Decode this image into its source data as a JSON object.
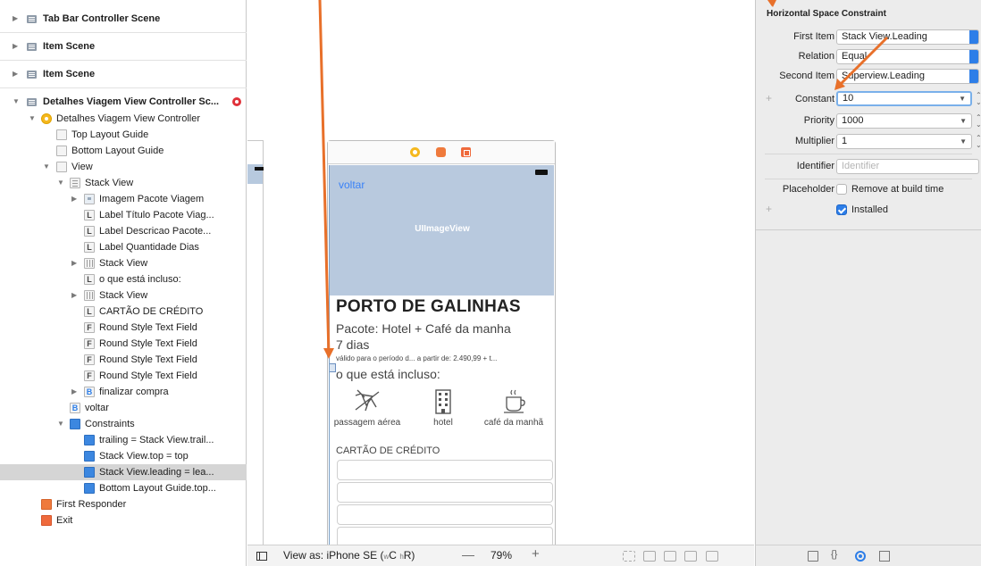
{
  "outline": {
    "scenes": [
      {
        "label": "Tab Bar Controller Scene"
      },
      {
        "label": "Item Scene"
      },
      {
        "label": "Item Scene"
      },
      {
        "label": "Detalhes Viagem View Controller Sc..."
      }
    ],
    "rows": [
      {
        "label": "Detalhes Viagem View Controller"
      },
      {
        "label": "Top Layout Guide"
      },
      {
        "label": "Bottom Layout Guide"
      },
      {
        "label": "View"
      },
      {
        "label": "Stack View"
      },
      {
        "label": "Imagem Pacote Viagem"
      },
      {
        "label": "Label Título Pacote Viag..."
      },
      {
        "label": "Label Descricao Pacote..."
      },
      {
        "label": "Label Quantidade Dias"
      },
      {
        "label": "Stack View"
      },
      {
        "label": "o que está incluso:"
      },
      {
        "label": "Stack View"
      },
      {
        "label": "CARTÃO DE CRÉDITO"
      },
      {
        "label": "Round Style Text Field"
      },
      {
        "label": "Round Style Text Field"
      },
      {
        "label": "Round Style Text Field"
      },
      {
        "label": "Round Style Text Field"
      },
      {
        "label": "finalizar compra"
      },
      {
        "label": "voltar"
      },
      {
        "label": "Constraints"
      },
      {
        "label": "trailing = Stack View.trail..."
      },
      {
        "label": "Stack View.top = top"
      },
      {
        "label": "Stack View.leading = lea..."
      },
      {
        "label": "Bottom Layout Guide.top..."
      },
      {
        "label": "First Responder"
      },
      {
        "label": "Exit"
      }
    ],
    "icon_letters": {
      "label": "L",
      "field": "F",
      "button": "B"
    }
  },
  "canvas": {
    "voltar": "voltar",
    "image_placeholder": "UIImageView",
    "title": "PORTO DE GALINHAS",
    "pacote": "Pacote: Hotel + Café da manha",
    "dias": "7 dias",
    "validade": "válido para o período d... a partir de: 2.490,99 + t...",
    "incluso": "o que está incluso:",
    "features": [
      {
        "label": "passagem aérea",
        "icon": "airplane-icon"
      },
      {
        "label": "hotel",
        "icon": "hotel-icon"
      },
      {
        "label": "café da manhã",
        "icon": "coffee-cup-icon"
      }
    ],
    "cartao": "CARTÃO DE CRÉDITO"
  },
  "bottombar": {
    "view_as": "View as: iPhone SE (",
    "size_class_w": "w",
    "size_class_c": "C",
    "size_class_h": "h",
    "size_class_r": "R)",
    "zoom_minus": "—",
    "zoom": "79%",
    "zoom_plus": "+"
  },
  "inspector": {
    "title": "Horizontal Space Constraint",
    "first_item_label": "First Item",
    "first_item_value": "Stack View.Leading",
    "relation_label": "Relation",
    "relation_value": "Equal",
    "second_item_label": "Second Item",
    "second_item_value": "Superview.Leading",
    "constant_label": "Constant",
    "constant_value": "10",
    "priority_label": "Priority",
    "priority_value": "1000",
    "multiplier_label": "Multiplier",
    "multiplier_value": "1",
    "identifier_label": "Identifier",
    "identifier_placeholder": "Identifier",
    "placeholder_label": "Placeholder",
    "remove_label": "Remove at build time",
    "installed_label": "Installed",
    "plus": "+"
  },
  "colors": {
    "accent": "#2d7ee8",
    "arrow": "#e8702a",
    "hero": "#b8c9de",
    "link": "#3a82f7"
  }
}
